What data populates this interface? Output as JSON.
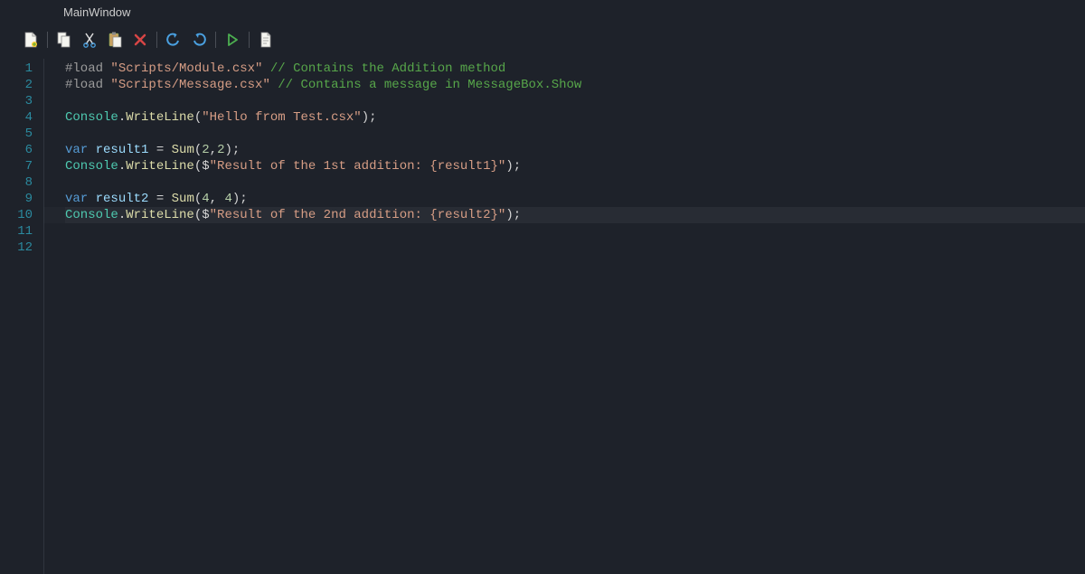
{
  "window": {
    "title": "MainWindow"
  },
  "toolbar": {
    "items": [
      {
        "name": "new-file-icon"
      },
      {
        "sep": true
      },
      {
        "name": "copy-icon"
      },
      {
        "name": "cut-icon"
      },
      {
        "name": "paste-icon"
      },
      {
        "name": "delete-icon"
      },
      {
        "sep": true
      },
      {
        "name": "undo-icon"
      },
      {
        "name": "redo-icon"
      },
      {
        "sep": true
      },
      {
        "name": "run-icon"
      },
      {
        "sep": true
      },
      {
        "name": "document-icon"
      }
    ]
  },
  "editor": {
    "highlight_line": 10,
    "line_count": 12,
    "lines": {
      "1": {
        "pp": "#load ",
        "str": "\"Scripts/Module.csx\"",
        "sp": " ",
        "cmt": "// Contains the Addition method"
      },
      "2": {
        "pp": "#load ",
        "str": "\"Scripts/Message.csx\"",
        "sp": " ",
        "cmt": "// Contains a message in MessageBox.Show"
      },
      "4": {
        "type": "Console",
        "dot": ".",
        "method": "WriteLine",
        "open": "(",
        "str": "\"Hello from Test.csx\"",
        "close": ");"
      },
      "6": {
        "kw": "var ",
        "ident": "result1",
        "eq": " = ",
        "method": "Sum",
        "open": "(",
        "n1": "2",
        "comma": ",",
        "n2": "2",
        "close": ");"
      },
      "7": {
        "type": "Console",
        "dot": ".",
        "method": "WriteLine",
        "open": "(",
        "dollar": "$",
        "str": "\"Result of the 1st addition: {result1}\"",
        "close": ");"
      },
      "9": {
        "kw": "var ",
        "ident": "result2",
        "eq": " = ",
        "method": "Sum",
        "open": "(",
        "n1": "4",
        "comma": ", ",
        "n2": "4",
        "close": ");"
      },
      "10": {
        "type": "Console",
        "dot": ".",
        "method": "WriteLine",
        "open": "(",
        "dollar": "$",
        "str": "\"Result of the 2nd addition: {result2}\"",
        "close": ");"
      }
    },
    "line_numbers": [
      "1",
      "2",
      "3",
      "4",
      "5",
      "6",
      "7",
      "8",
      "9",
      "10",
      "11",
      "12"
    ]
  }
}
